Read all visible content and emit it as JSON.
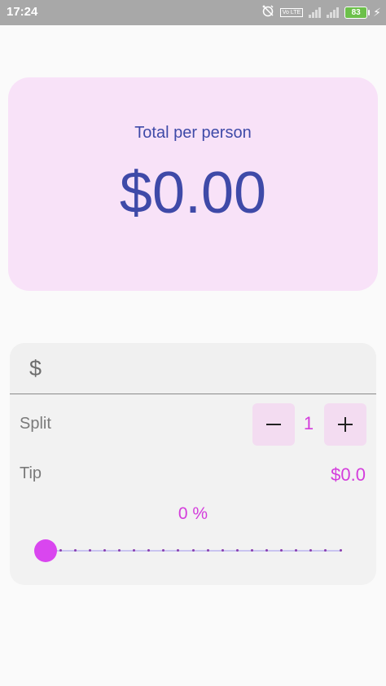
{
  "status_bar": {
    "time": "17:24",
    "volte_label": "Vo LTE",
    "battery": "83",
    "icons": [
      "alarm-off-icon",
      "volte-icon",
      "signal-icon",
      "battery-icon",
      "charging-bolt-icon"
    ]
  },
  "summary": {
    "label": "Total per person",
    "amount": "$0.00"
  },
  "bill": {
    "prefix": "$",
    "value": "",
    "placeholder": ""
  },
  "split": {
    "label": "Split",
    "count": "1",
    "minus_symbol": "−",
    "plus_symbol": "+"
  },
  "tip": {
    "label": "Tip",
    "amount": "$0.0",
    "percent_text": "0 %",
    "slider_value": 0,
    "slider_min": 0,
    "slider_max": 100
  },
  "colors": {
    "accent": "#d946ef",
    "accent_text": "#d43ddc",
    "primary_text": "#3f4aa8",
    "summary_card_bg": "#f8e2f8",
    "stepper_bg": "#f3dcf1",
    "status_bar_bg": "#a8a8a8"
  }
}
